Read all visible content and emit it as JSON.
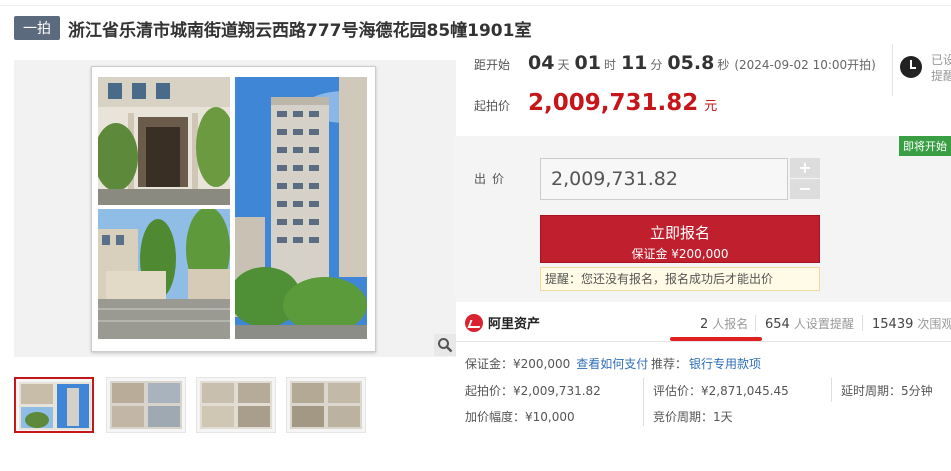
{
  "header": {
    "tag": "一拍",
    "title": "浙江省乐清市城南街道翔云西路777号海德花园85幢1901室"
  },
  "countdown": {
    "label": "距开始",
    "days": "04",
    "days_unit": "天",
    "hours": "01",
    "hours_unit": "时",
    "minutes": "11",
    "minutes_unit": "分",
    "seconds": "05.8",
    "seconds_unit": "秒",
    "note": "(2024-09-02 10:00开拍)"
  },
  "start_price": {
    "label": "起拍价",
    "value": "2,009,731.82",
    "unit": "元"
  },
  "reminder": {
    "line1": "已设",
    "line2": "提醒"
  },
  "bid": {
    "soon_tag": "即将开始",
    "label": "出价",
    "input_value": "2,009,731.82",
    "plus": "+",
    "minus": "−",
    "apply_label": "立即报名",
    "deposit_label": "保证金 ¥200,000",
    "tip": "提醒：您还没有报名，报名成功后才能出价"
  },
  "stats": {
    "brand": "阿里资产",
    "registered_count": "2",
    "registered_unit": "人报名",
    "reminder_count": "654",
    "reminder_unit": "人设置提醒",
    "views_count": "15439",
    "views_unit": "次围观"
  },
  "info": {
    "deposit": "保证金：¥200,000",
    "how_to_pay": "查看如何支付",
    "recommend_label": "推荐：",
    "recommend_link": "银行专用款项",
    "start_price": "起拍价：¥2,009,731.82",
    "appraisal": "评估价：¥2,871,045.45",
    "delay": "延时周期：5分钟",
    "increment": "加价幅度：¥10,000",
    "bid_cycle": "竞价周期：1天"
  },
  "icons": {
    "zoom": "magnifier-icon",
    "clock": "clock-icon",
    "logo": "ali-asset-logo-icon"
  },
  "colors": {
    "accent_red": "#c6161a",
    "button_red": "#c0202e",
    "link_blue": "#2f6fb7",
    "soon_green": "#3a9e44"
  }
}
